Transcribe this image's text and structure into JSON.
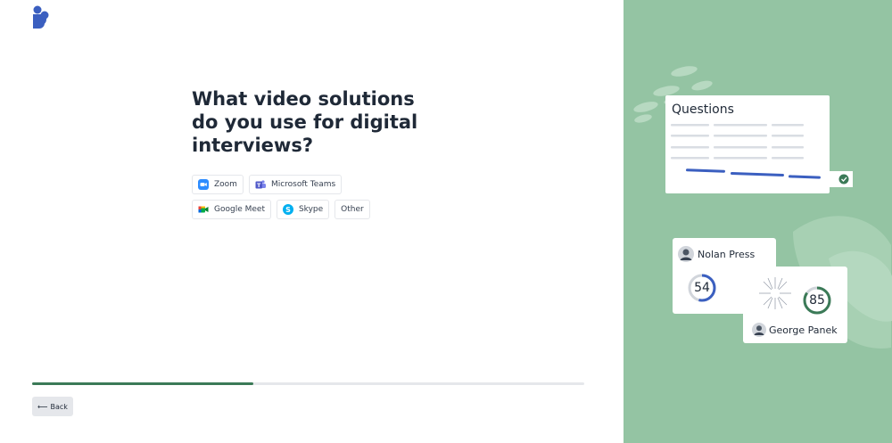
{
  "question": {
    "title": "What video solutions do you use for digital interviews?"
  },
  "options": [
    {
      "label": "Zoom",
      "icon": "zoom-icon"
    },
    {
      "label": "Microsoft Teams",
      "icon": "teams-icon"
    },
    {
      "label": "Google Meet",
      "icon": "meet-icon"
    },
    {
      "label": "Skype",
      "icon": "skype-icon"
    },
    {
      "label": "Other",
      "icon": null
    }
  ],
  "progress": {
    "fraction": 0.4
  },
  "nav": {
    "back_label": "Back"
  },
  "illustration": {
    "questions_title": "Questions",
    "candidate_1": {
      "name": "Nolan Press",
      "score": "54"
    },
    "candidate_2": {
      "name": "George Panek",
      "score": "85"
    }
  },
  "colors": {
    "panel_bg": "#94c4a3",
    "accent_blue": "#3b5fc0",
    "progress": "#3b7a57"
  }
}
